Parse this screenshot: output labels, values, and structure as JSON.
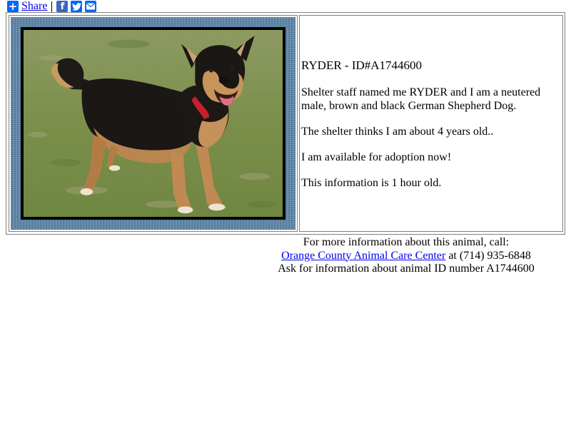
{
  "share": {
    "label": "Share",
    "icons": [
      "plus-icon",
      "facebook-icon",
      "twitter-icon",
      "email-icon"
    ]
  },
  "animal": {
    "title": "RYDER - ID#A1744600",
    "description": "Shelter staff named me RYDER and I am a neutered male, brown and black German Shepherd Dog.",
    "age": "The shelter thinks I am about 4 years old..",
    "availability": "I am available for adoption now!",
    "freshness": "This information is 1 hour old."
  },
  "contact": {
    "line1": "For more information about this animal, call:",
    "center_name": "Orange County Animal Care Center",
    "phone_text": " at (714) 935-6848",
    "line3": "Ask for information about animal ID number A1744600"
  },
  "colors": {
    "link": "#0000ee",
    "share_icon": "#0166ff",
    "frame": "#5d87aa"
  }
}
